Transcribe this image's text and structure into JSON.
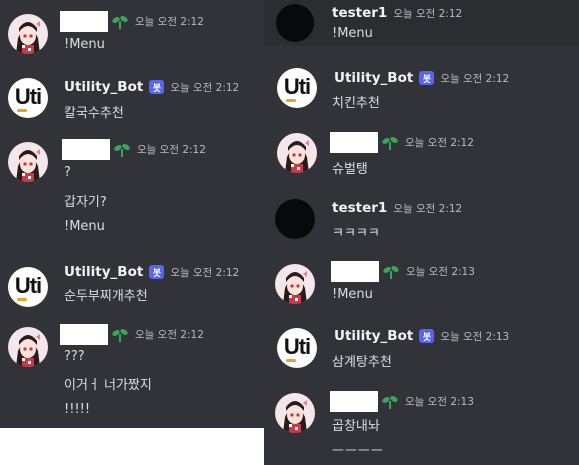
{
  "left": {
    "messages": [
      {
        "author": "",
        "redacted": true,
        "timestamp": "오늘 오전 2:12",
        "lines": [
          "!Menu"
        ]
      },
      {
        "author": "Utility_Bot",
        "bot_tag": "봇",
        "timestamp": "오늘 오전 2:12",
        "lines": [
          "칼국수추천"
        ]
      },
      {
        "author": "",
        "redacted": true,
        "timestamp": "오늘 오전 2:12",
        "lines": [
          "?",
          "갑자기?",
          "!Menu"
        ]
      },
      {
        "author": "Utility_Bot",
        "bot_tag": "봇",
        "timestamp": "오늘 오전 2:12",
        "lines": [
          "순두부찌개추천"
        ]
      },
      {
        "author": "",
        "redacted": true,
        "timestamp": "오늘 오전 2:12",
        "lines": [
          "???",
          "이거ㅓ 너가짰지",
          "!!!!!"
        ]
      }
    ]
  },
  "right": {
    "messages": [
      {
        "author": "tester1",
        "timestamp": "오늘 오전 2:12",
        "lines": [
          "!Menu"
        ]
      },
      {
        "author": "Utility_Bot",
        "bot_tag": "봇",
        "timestamp": "오늘 오전 2:12",
        "lines": [
          "치킨추천"
        ]
      },
      {
        "author": "",
        "redacted": true,
        "timestamp": "오늘 오전 2:12",
        "lines": [
          "슈벌탱"
        ]
      },
      {
        "author": "tester1",
        "timestamp": "오늘 오전 2:12",
        "lines": [
          "ㅋㅋㅋㅋ"
        ]
      },
      {
        "author": "",
        "redacted": true,
        "timestamp": "오늘 오전 2:13",
        "lines": [
          "!Menu"
        ]
      },
      {
        "author": "Utility_Bot",
        "bot_tag": "봇",
        "timestamp": "오늘 오전 2:13",
        "lines": [
          "삼계탕추천"
        ]
      },
      {
        "author": "",
        "redacted": true,
        "timestamp": "오늘 오전 2:13",
        "lines": [
          "곱창내놔",
          "ㅡㅡㅡㅡ"
        ]
      }
    ]
  },
  "avatar_labels": {
    "bot_logo_text": "Uti"
  },
  "colors": {
    "background": "#313338",
    "highlight": "#2b2d31",
    "bot_tag": "#5865f2",
    "text": "#dbdee1",
    "timestamp": "#b5bac1",
    "name": "#f2f3f5",
    "sprout": "#3ba55d"
  },
  "icons": {
    "user_avatar": "anime-girl-avatar-icon",
    "bot_avatar": "uti-logo-icon",
    "tester_avatar": "black-circle-avatar-icon",
    "role_icon": "sprout-icon"
  }
}
